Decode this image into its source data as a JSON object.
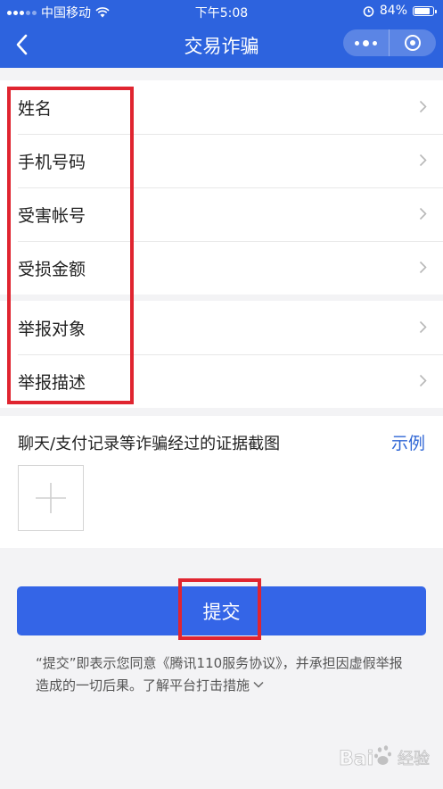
{
  "status_bar": {
    "carrier": "中国移动",
    "time": "下午5:08",
    "battery_percent_label": "84%",
    "battery_level": 0.84
  },
  "nav": {
    "title": "交易诈骗",
    "back_icon": "chevron-left-icon",
    "more_icon": "more-dots-icon",
    "close_icon": "target-circle-icon"
  },
  "form": {
    "group1": [
      {
        "label": "姓名"
      },
      {
        "label": "手机号码"
      },
      {
        "label": "受害帐号"
      },
      {
        "label": "受损金额"
      }
    ],
    "group2": [
      {
        "label": "举报对象"
      },
      {
        "label": "举报描述"
      }
    ],
    "evidence": {
      "label": "聊天/支付记录等诈骗经过的证据截图",
      "example_link": "示例"
    }
  },
  "submit": {
    "label": "提交"
  },
  "disclaimer": {
    "text": "“提交”即表示您同意《腾讯110服务协议》，并承担因虚假举报造成的一切后果。",
    "measures_link": "了解平台打击措施"
  },
  "colors": {
    "header_bg": "#2d63de",
    "submit_bg": "#3465e7",
    "link": "#2f66d5",
    "highlight": "#e02530",
    "page_bg": "#f3f3f5"
  },
  "watermark": {
    "text": "Baidu 经验"
  }
}
